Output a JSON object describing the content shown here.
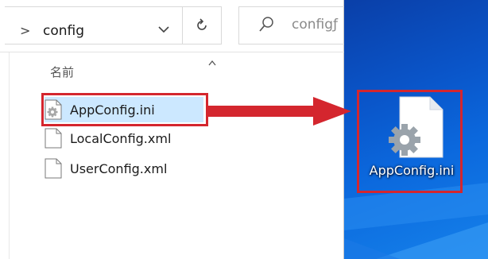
{
  "address_bar": {
    "breadcrumb_chevron": ">",
    "current_folder": "config",
    "dropdown_icon": "chevron-down-icon",
    "refresh_icon": "refresh-icon"
  },
  "search": {
    "placeholder_visible": "configƒ",
    "icon": "search-icon"
  },
  "file_list": {
    "column_header": "名前",
    "sort_indicator": "sort-ascending-caret",
    "files": [
      {
        "name": "AppConfig.ini",
        "icon": "ini-settings-file-icon",
        "selected": true
      },
      {
        "name": "LocalConfig.xml",
        "icon": "blank-file-icon",
        "selected": false
      },
      {
        "name": "UserConfig.xml",
        "icon": "blank-file-icon",
        "selected": false
      }
    ]
  },
  "desktop": {
    "icon_label": "AppConfig.ini",
    "icon": "ini-settings-file-icon"
  },
  "colors": {
    "highlight_red": "#d4262e",
    "selection_blue": "#cce8ff",
    "desktop_blue": "#0a55c9"
  }
}
